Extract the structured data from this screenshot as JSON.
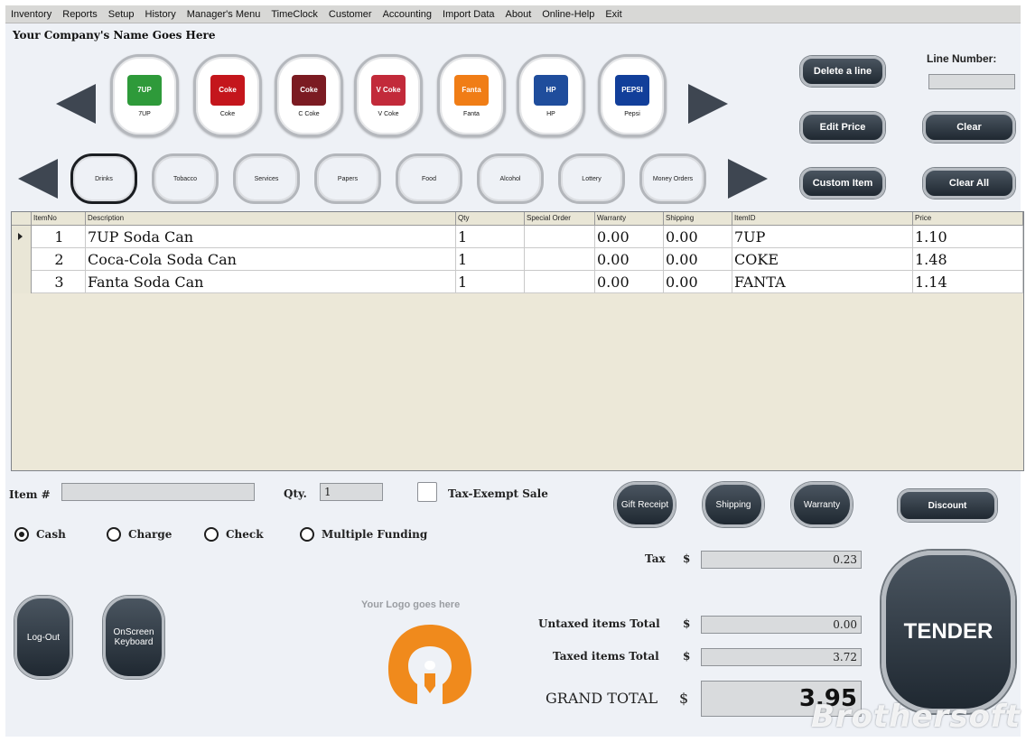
{
  "menu": [
    "Inventory",
    "Reports",
    "Setup",
    "History",
    "Manager's Menu",
    "TimeClock",
    "Customer",
    "Accounting",
    "Import Data",
    "About",
    "Online-Help",
    "Exit"
  ],
  "company_name": "Your Company's Name Goes Here",
  "products": [
    {
      "label": "7UP",
      "logo": "7UP",
      "color": "#2e9a3a"
    },
    {
      "label": "Coke",
      "logo": "Coke",
      "color": "#c4161c"
    },
    {
      "label": "C Coke",
      "logo": "Coke",
      "color": "#7b1b22"
    },
    {
      "label": "V Coke",
      "logo": "V Coke",
      "color": "#c22a3a"
    },
    {
      "label": "Fanta",
      "logo": "Fanta",
      "color": "#f07d16"
    },
    {
      "label": "HP",
      "logo": "HP",
      "color": "#1f4d9c"
    },
    {
      "label": "Pepsi",
      "logo": "PEPSI",
      "color": "#123f9a"
    }
  ],
  "categories": [
    {
      "label": "Drinks",
      "active": true
    },
    {
      "label": "Tobacco"
    },
    {
      "label": "Services"
    },
    {
      "label": "Papers"
    },
    {
      "label": "Food"
    },
    {
      "label": "Alcohol"
    },
    {
      "label": "Lottery"
    },
    {
      "label": "Money Orders"
    }
  ],
  "actions": {
    "delete_line": "Delete a line",
    "edit_price": "Edit Price",
    "clear": "Clear",
    "custom_item": "Custom Item",
    "clear_all": "Clear All",
    "line_number_label": "Line Number:",
    "gift_receipt": "Gift Receipt",
    "shipping": "Shipping",
    "warranty": "Warranty",
    "discount": "Discount",
    "logout": "Log-Out",
    "onscreen_keyboard": "OnScreen Keyboard",
    "tender": "TENDER"
  },
  "grid": {
    "columns": [
      "ItemNo",
      "Description",
      "Qty",
      "Special Order",
      "Warranty",
      "Shipping",
      "ItemID",
      "Price"
    ],
    "rows": [
      {
        "itemno": "1",
        "description": "7UP Soda Can",
        "qty": "1",
        "special_order": "",
        "warranty": "0.00",
        "shipping": "0.00",
        "itemid": "7UP",
        "price": "1.10"
      },
      {
        "itemno": "2",
        "description": "Coca-Cola Soda Can",
        "qty": "1",
        "special_order": "",
        "warranty": "0.00",
        "shipping": "0.00",
        "itemid": "COKE",
        "price": "1.48"
      },
      {
        "itemno": "3",
        "description": "Fanta Soda Can",
        "qty": "1",
        "special_order": "",
        "warranty": "0.00",
        "shipping": "0.00",
        "itemid": "FANTA",
        "price": "1.14"
      }
    ]
  },
  "entry": {
    "item_label": "Item #",
    "item_value": "",
    "qty_label": "Qty.",
    "qty_value": "1",
    "tax_exempt_label": "Tax-Exempt Sale"
  },
  "payment": {
    "options": [
      "Cash",
      "Charge",
      "Check",
      "Multiple Funding"
    ],
    "selected": "Cash"
  },
  "logo_text": "Your Logo goes here",
  "totals": {
    "tax_label": "Tax",
    "tax": "0.23",
    "untaxed_label": "Untaxed items Total",
    "untaxed": "0.00",
    "taxed_label": "Taxed items Total",
    "taxed": "3.72",
    "grand_label": "GRAND TOTAL",
    "grand": "3.95",
    "currency": "$"
  },
  "watermark": "Brothersoft"
}
